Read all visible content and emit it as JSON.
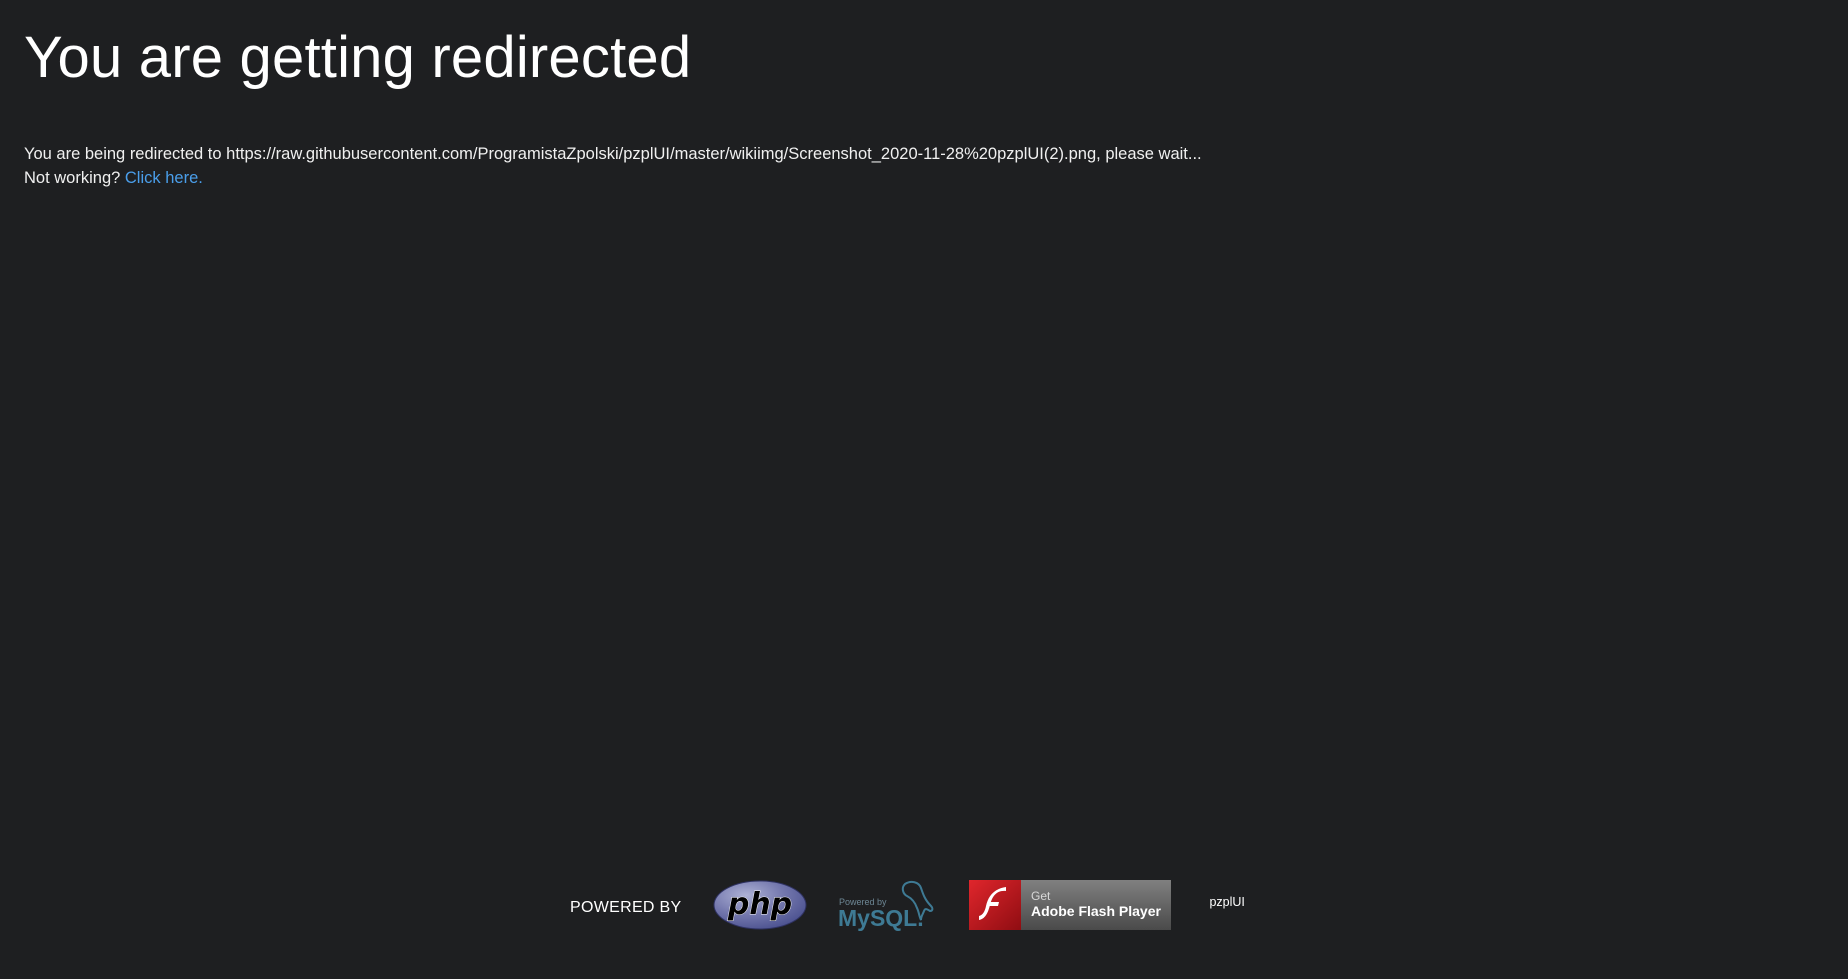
{
  "page": {
    "title": "You are getting redirected",
    "redirect_prefix": "You are being redirected to",
    "redirect_url": "https://raw.githubusercontent.com/ProgramistaZpolski/pzplUI/master/wikiimg/Screenshot_2020-11-28%20pzplUI(2).png",
    "redirect_suffix": ", please wait...",
    "not_working_label": "Not working?",
    "click_here_label": "Click here."
  },
  "footer": {
    "powered_by": "POWERED BY",
    "php_label": "php",
    "mysql_small": "Powered by",
    "mysql_label": "MySQL.",
    "flash_get": "Get",
    "flash_label": "Adobe Flash Player",
    "app_name": "pzplUI"
  },
  "colors": {
    "background": "#1e1f21",
    "link": "#4a9eea",
    "php": "#7377ad",
    "mysql_blue": "#3e7a94",
    "mysql_orange": "#e48e00",
    "flash_red": "#c21a20"
  }
}
